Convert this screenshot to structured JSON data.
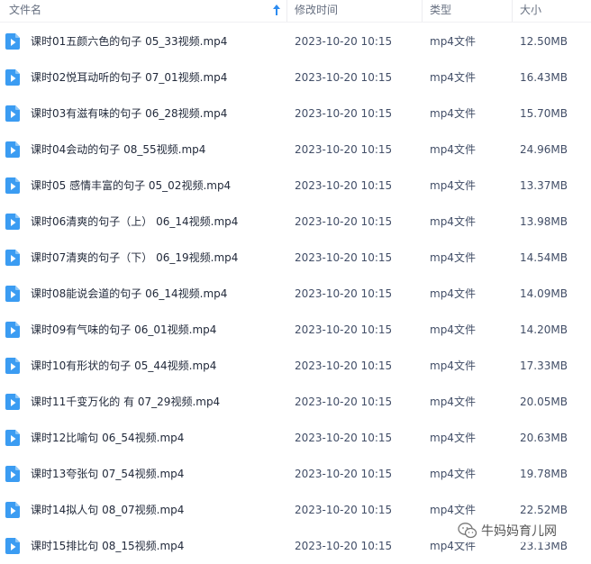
{
  "header": {
    "name": "文件名",
    "modified": "修改时间",
    "type": "类型",
    "size": "大小"
  },
  "colors": {
    "file_icon": "#3b9cf2",
    "sort_arrow": "#2d8cf0"
  },
  "files": [
    {
      "name": "课时01五颜六色的句子 05_33视频.mp4",
      "modified": "2023-10-20 10:15",
      "type": "mp4文件",
      "size": "12.50MB"
    },
    {
      "name": "课时02悦耳动听的句子 07_01视频.mp4",
      "modified": "2023-10-20 10:15",
      "type": "mp4文件",
      "size": "16.43MB"
    },
    {
      "name": "课时03有滋有味的句子 06_28视频.mp4",
      "modified": "2023-10-20 10:15",
      "type": "mp4文件",
      "size": "15.70MB"
    },
    {
      "name": "课时04会动的句子 08_55视频.mp4",
      "modified": "2023-10-20 10:15",
      "type": "mp4文件",
      "size": "24.96MB"
    },
    {
      "name": "课时05 感情丰富的句子 05_02视频.mp4",
      "modified": "2023-10-20 10:15",
      "type": "mp4文件",
      "size": "13.37MB"
    },
    {
      "name": "课时06清爽的句子（上） 06_14视频.mp4",
      "modified": "2023-10-20 10:15",
      "type": "mp4文件",
      "size": "13.98MB"
    },
    {
      "name": "课时07清爽的句子（下） 06_19视频.mp4",
      "modified": "2023-10-20 10:15",
      "type": "mp4文件",
      "size": "14.54MB"
    },
    {
      "name": "课时08能说会道的句子 06_14视频.mp4",
      "modified": "2023-10-20 10:15",
      "type": "mp4文件",
      "size": "14.09MB"
    },
    {
      "name": "课时09有气味的句子 06_01视频.mp4",
      "modified": "2023-10-20 10:15",
      "type": "mp4文件",
      "size": "14.20MB"
    },
    {
      "name": "课时10有形状的句子 05_44视频.mp4",
      "modified": "2023-10-20 10:15",
      "type": "mp4文件",
      "size": "17.33MB"
    },
    {
      "name": "课时11千变万化的 有 07_29视频.mp4",
      "modified": "2023-10-20 10:15",
      "type": "mp4文件",
      "size": "20.05MB"
    },
    {
      "name": "课时12比喻句 06_54视频.mp4",
      "modified": "2023-10-20 10:15",
      "type": "mp4文件",
      "size": "20.63MB"
    },
    {
      "name": "课时13夸张句 07_54视频.mp4",
      "modified": "2023-10-20 10:15",
      "type": "mp4文件",
      "size": "19.78MB"
    },
    {
      "name": "课时14拟人句 08_07视频.mp4",
      "modified": "2023-10-20 10:15",
      "type": "mp4文件",
      "size": "22.52MB"
    },
    {
      "name": "课时15排比句 08_15视频.mp4",
      "modified": "2023-10-20 10:15",
      "type": "mp4文件",
      "size": "23.13MB"
    }
  ],
  "watermark": {
    "text": "牛妈妈育儿网"
  }
}
